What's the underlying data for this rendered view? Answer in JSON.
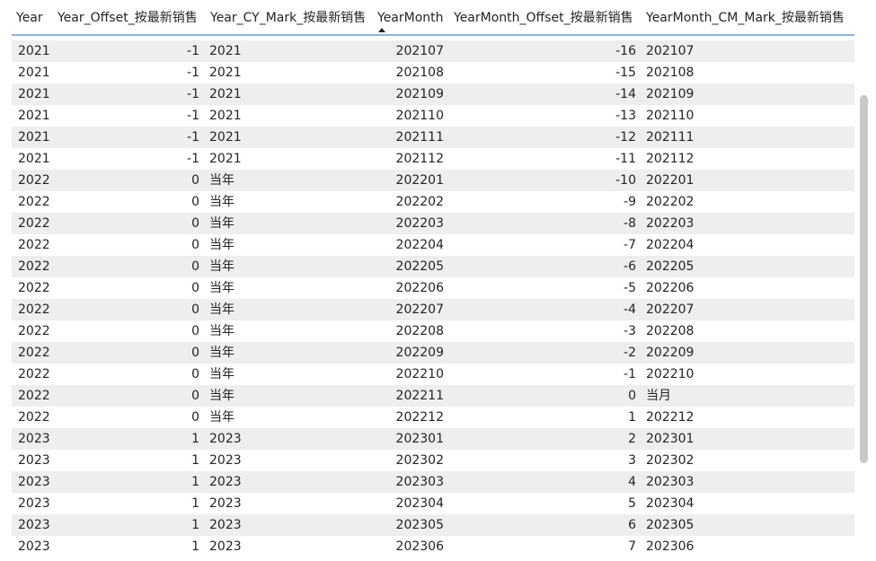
{
  "table": {
    "columns": [
      {
        "key": "year",
        "label": "Year"
      },
      {
        "key": "year_offset",
        "label": "Year_Offset_按最新销售"
      },
      {
        "key": "year_cy_mark",
        "label": "Year_CY_Mark_按最新销售"
      },
      {
        "key": "yearmonth",
        "label": "YearMonth"
      },
      {
        "key": "yearmonth_offset",
        "label": "YearMonth_Offset_按最新销售"
      },
      {
        "key": "yearmonth_cm_mark",
        "label": "YearMonth_CM_Mark_按最新销售"
      }
    ],
    "sort": {
      "column": "YearMonth",
      "direction": "ascending"
    },
    "rows": [
      {
        "year": "2021",
        "year_offset": "-1",
        "year_cy_mark": "2021",
        "yearmonth": "202107",
        "yearmonth_offset": "-16",
        "yearmonth_cm_mark": "202107"
      },
      {
        "year": "2021",
        "year_offset": "-1",
        "year_cy_mark": "2021",
        "yearmonth": "202108",
        "yearmonth_offset": "-15",
        "yearmonth_cm_mark": "202108"
      },
      {
        "year": "2021",
        "year_offset": "-1",
        "year_cy_mark": "2021",
        "yearmonth": "202109",
        "yearmonth_offset": "-14",
        "yearmonth_cm_mark": "202109"
      },
      {
        "year": "2021",
        "year_offset": "-1",
        "year_cy_mark": "2021",
        "yearmonth": "202110",
        "yearmonth_offset": "-13",
        "yearmonth_cm_mark": "202110"
      },
      {
        "year": "2021",
        "year_offset": "-1",
        "year_cy_mark": "2021",
        "yearmonth": "202111",
        "yearmonth_offset": "-12",
        "yearmonth_cm_mark": "202111"
      },
      {
        "year": "2021",
        "year_offset": "-1",
        "year_cy_mark": "2021",
        "yearmonth": "202112",
        "yearmonth_offset": "-11",
        "yearmonth_cm_mark": "202112"
      },
      {
        "year": "2022",
        "year_offset": "0",
        "year_cy_mark": "当年",
        "yearmonth": "202201",
        "yearmonth_offset": "-10",
        "yearmonth_cm_mark": "202201"
      },
      {
        "year": "2022",
        "year_offset": "0",
        "year_cy_mark": "当年",
        "yearmonth": "202202",
        "yearmonth_offset": "-9",
        "yearmonth_cm_mark": "202202"
      },
      {
        "year": "2022",
        "year_offset": "0",
        "year_cy_mark": "当年",
        "yearmonth": "202203",
        "yearmonth_offset": "-8",
        "yearmonth_cm_mark": "202203"
      },
      {
        "year": "2022",
        "year_offset": "0",
        "year_cy_mark": "当年",
        "yearmonth": "202204",
        "yearmonth_offset": "-7",
        "yearmonth_cm_mark": "202204"
      },
      {
        "year": "2022",
        "year_offset": "0",
        "year_cy_mark": "当年",
        "yearmonth": "202205",
        "yearmonth_offset": "-6",
        "yearmonth_cm_mark": "202205"
      },
      {
        "year": "2022",
        "year_offset": "0",
        "year_cy_mark": "当年",
        "yearmonth": "202206",
        "yearmonth_offset": "-5",
        "yearmonth_cm_mark": "202206"
      },
      {
        "year": "2022",
        "year_offset": "0",
        "year_cy_mark": "当年",
        "yearmonth": "202207",
        "yearmonth_offset": "-4",
        "yearmonth_cm_mark": "202207"
      },
      {
        "year": "2022",
        "year_offset": "0",
        "year_cy_mark": "当年",
        "yearmonth": "202208",
        "yearmonth_offset": "-3",
        "yearmonth_cm_mark": "202208"
      },
      {
        "year": "2022",
        "year_offset": "0",
        "year_cy_mark": "当年",
        "yearmonth": "202209",
        "yearmonth_offset": "-2",
        "yearmonth_cm_mark": "202209"
      },
      {
        "year": "2022",
        "year_offset": "0",
        "year_cy_mark": "当年",
        "yearmonth": "202210",
        "yearmonth_offset": "-1",
        "yearmonth_cm_mark": "202210"
      },
      {
        "year": "2022",
        "year_offset": "0",
        "year_cy_mark": "当年",
        "yearmonth": "202211",
        "yearmonth_offset": "0",
        "yearmonth_cm_mark": "当月"
      },
      {
        "year": "2022",
        "year_offset": "0",
        "year_cy_mark": "当年",
        "yearmonth": "202212",
        "yearmonth_offset": "1",
        "yearmonth_cm_mark": "202212"
      },
      {
        "year": "2023",
        "year_offset": "1",
        "year_cy_mark": "2023",
        "yearmonth": "202301",
        "yearmonth_offset": "2",
        "yearmonth_cm_mark": "202301"
      },
      {
        "year": "2023",
        "year_offset": "1",
        "year_cy_mark": "2023",
        "yearmonth": "202302",
        "yearmonth_offset": "3",
        "yearmonth_cm_mark": "202302"
      },
      {
        "year": "2023",
        "year_offset": "1",
        "year_cy_mark": "2023",
        "yearmonth": "202303",
        "yearmonth_offset": "4",
        "yearmonth_cm_mark": "202303"
      },
      {
        "year": "2023",
        "year_offset": "1",
        "year_cy_mark": "2023",
        "yearmonth": "202304",
        "yearmonth_offset": "5",
        "yearmonth_cm_mark": "202304"
      },
      {
        "year": "2023",
        "year_offset": "1",
        "year_cy_mark": "2023",
        "yearmonth": "202305",
        "yearmonth_offset": "6",
        "yearmonth_cm_mark": "202305"
      },
      {
        "year": "2023",
        "year_offset": "1",
        "year_cy_mark": "2023",
        "yearmonth": "202306",
        "yearmonth_offset": "7",
        "yearmonth_cm_mark": "202306"
      }
    ]
  },
  "icons": {
    "sort": "sort-ascending-icon"
  },
  "colors": {
    "header_border": "#8fb5de",
    "row_alt": "#eeeeee",
    "text": "#252423",
    "scrollbar": "#c8c8c8"
  }
}
